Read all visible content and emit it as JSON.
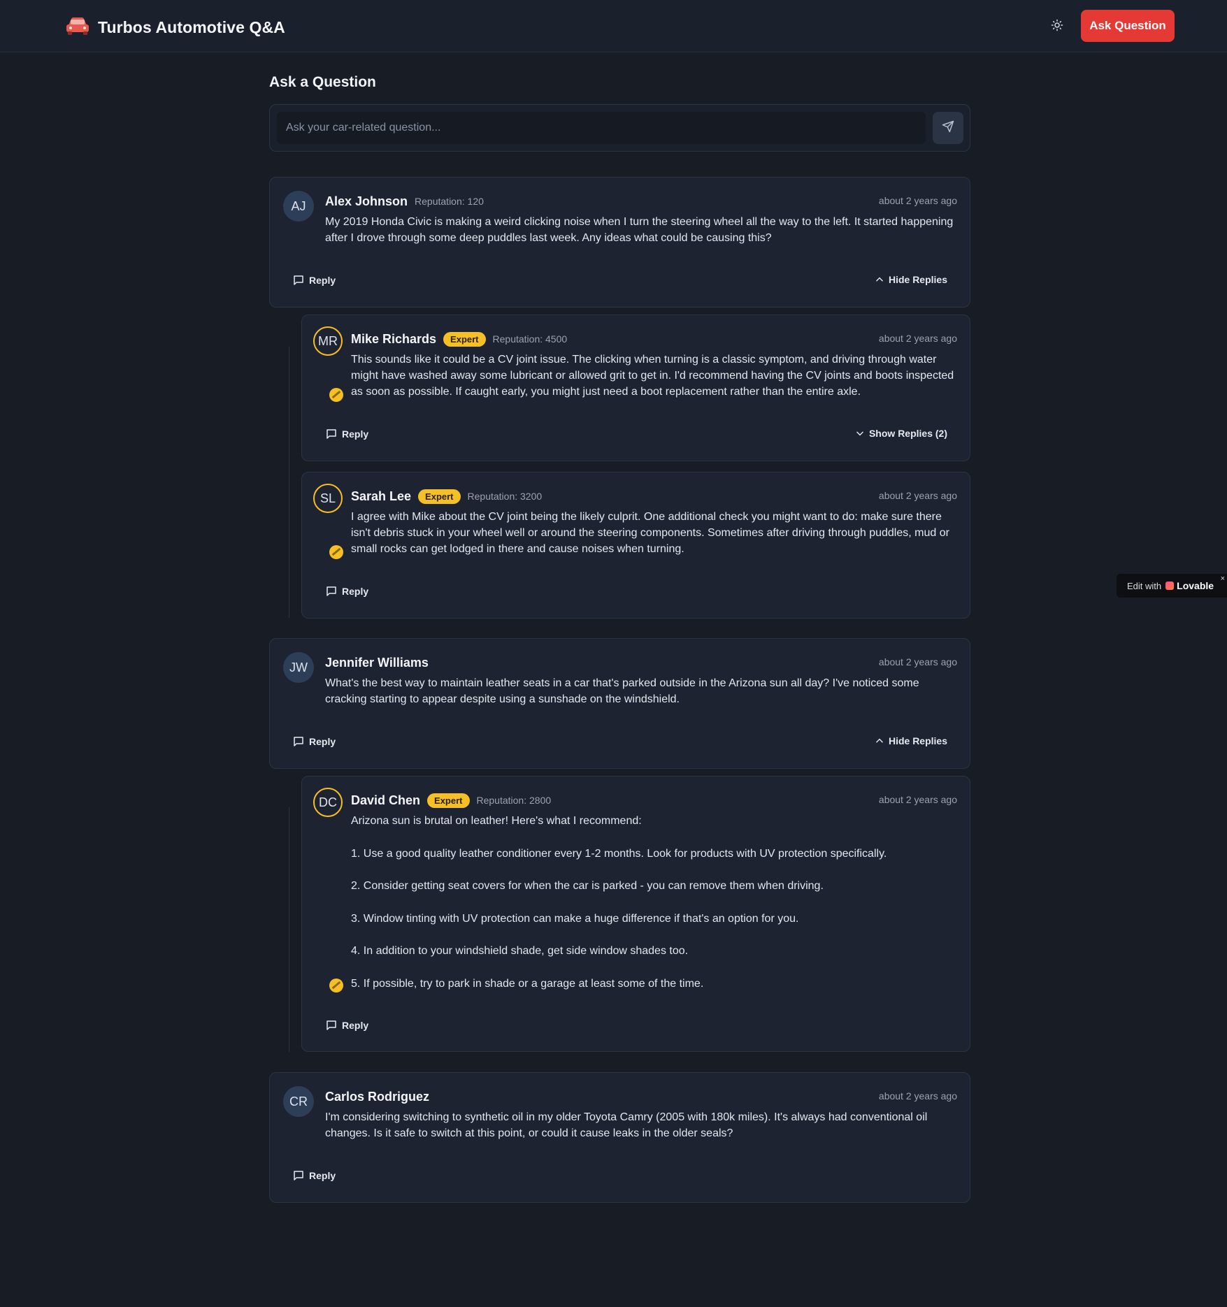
{
  "header": {
    "title": "Turbos Automotive Q&A",
    "ask_button": "Ask Question",
    "logo_icon": "car-icon",
    "theme_icon": "sun-icon"
  },
  "ask": {
    "heading": "Ask a Question",
    "placeholder": "Ask your car-related question...",
    "send_icon": "send-icon"
  },
  "labels": {
    "reply": "Reply",
    "hide_replies": "Hide Replies",
    "show_replies": "Show Replies (2)",
    "expert": "Expert"
  },
  "questions": [
    {
      "initials": "AJ",
      "name": "Alex Johnson",
      "reputation": "Reputation: 120",
      "time": "about 2 years ago",
      "text": "My 2019 Honda Civic is making a weird clicking noise when I turn the steering wheel all the way to the left. It started happening after I drove through some deep puddles last week. Any ideas what could be causing this?",
      "replies": [
        {
          "initials": "MR",
          "name": "Mike Richards",
          "reputation": "Reputation: 4500",
          "time": "about 2 years ago",
          "text": "This sounds like it could be a CV joint issue. The clicking when turning is a classic symptom, and driving through water might have washed away some lubricant or allowed grit to get in. I'd recommend having the CV joints and boots inspected as soon as possible. If caught early, you might just need a boot replacement rather than the entire axle."
        },
        {
          "initials": "SL",
          "name": "Sarah Lee",
          "reputation": "Reputation: 3200",
          "time": "about 2 years ago",
          "text": "I agree with Mike about the CV joint being the likely culprit. One additional check you might want to do: make sure there isn't debris stuck in your wheel well or around the steering components. Sometimes after driving through puddles, mud or small rocks can get lodged in there and cause noises when turning."
        }
      ]
    },
    {
      "initials": "JW",
      "name": "Jennifer Williams",
      "time": "about 2 years ago",
      "text": "What's the best way to maintain leather seats in a car that's parked outside in the Arizona sun all day? I've noticed some cracking starting to appear despite using a sunshade on the windshield.",
      "replies": [
        {
          "initials": "DC",
          "name": "David Chen",
          "reputation": "Reputation: 2800",
          "time": "about 2 years ago",
          "paragraphs": [
            "Arizona sun is brutal on leather! Here's what I recommend:",
            "1. Use a good quality leather conditioner every 1-2 months. Look for products with UV protection specifically.",
            "2. Consider getting seat covers for when the car is parked - you can remove them when driving.",
            "3. Window tinting with UV protection can make a huge difference if that's an option for you.",
            "4. In addition to your windshield shade, get side window shades too.",
            "5. If possible, try to park in shade or a garage at least some of the time."
          ]
        }
      ]
    },
    {
      "initials": "CR",
      "name": "Carlos Rodriguez",
      "time": "about 2 years ago",
      "text": "I'm considering switching to synthetic oil in my older Toyota Camry (2005 with 180k miles). It's always had conventional oil changes. Is it safe to switch at this point, or could it cause leaks in the older seals?"
    }
  ],
  "lovable": {
    "edit_with": "Edit with",
    "brand": "Lovable",
    "close": "×"
  }
}
